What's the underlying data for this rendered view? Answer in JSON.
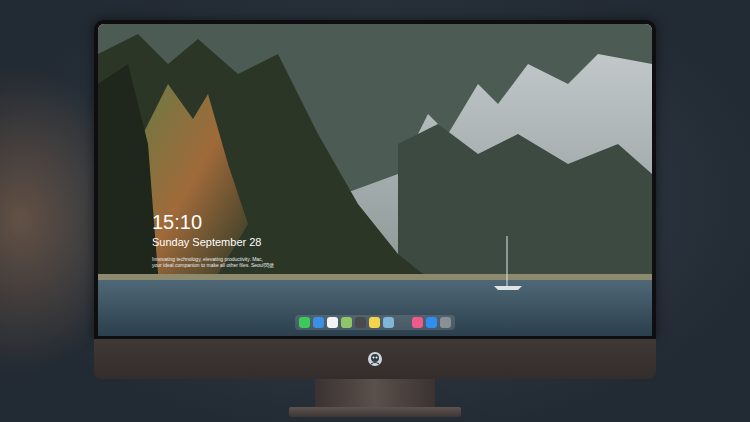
{
  "lock_screen": {
    "time": "15:10",
    "date": "Sunday September 28",
    "caption": [
      "Innovating technology, elevating productivity. Mac,",
      "your ideal companion to make all other files. Seoul閃捷"
    ]
  }
}
